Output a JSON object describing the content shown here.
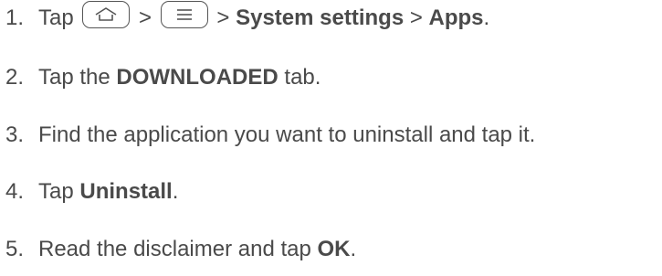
{
  "steps": [
    {
      "number": "1.",
      "parts": {
        "tap": "Tap",
        "gt1": ">",
        "gt2": ">",
        "system_settings": "System settings",
        "gt3": ">",
        "apps": "Apps",
        "period": "."
      },
      "icons": [
        "home-key-icon",
        "menu-key-icon"
      ]
    },
    {
      "number": "2.",
      "parts": {
        "tap_the": "Tap the",
        "downloaded": "DOWNLOADED",
        "tab": "tab."
      }
    },
    {
      "number": "3.",
      "text": "Find the application you want to uninstall and tap it."
    },
    {
      "number": "4.",
      "parts": {
        "tap": "Tap",
        "uninstall": "Uninstall",
        "period": "."
      }
    },
    {
      "number": "5.",
      "parts": {
        "read": "Read the disclaimer and tap",
        "ok": "OK",
        "period": "."
      }
    }
  ],
  "colors": {
    "text": "#4a4a4a",
    "key_border": "#555555"
  }
}
